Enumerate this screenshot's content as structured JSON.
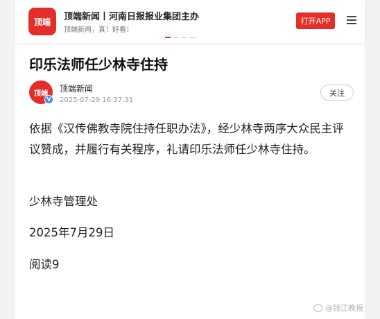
{
  "header": {
    "logo_text": "顶端",
    "brand": "顶端新闻丨河南日报报业集团主办",
    "slogan": "顶端新闻，真！好看！",
    "open_app_label": "打开APP",
    "menu_icon": "hamburger-menu-icon"
  },
  "article": {
    "title": "印乐法师任少林寺住持",
    "author": {
      "avatar_text": "顶端",
      "name": "顶端新闻",
      "timestamp": "2025-07-29 16:37:31",
      "verified_mark": "V",
      "follow_label": "关注"
    },
    "paragraphs": [
      "依据《汉传佛教寺院住持任职办法》，经少林寺两序大众民主评议赞成，并履行有关程序，礼请印乐法师任少林寺住持。",
      "少林寺管理处",
      "2025年7月29日"
    ],
    "read_count": "阅读9"
  },
  "watermark": {
    "text": "@钱江晚报",
    "icon": "weibo-icon"
  },
  "colors": {
    "brand_red": "#e52e2a",
    "verified_blue": "#3d8bef"
  }
}
